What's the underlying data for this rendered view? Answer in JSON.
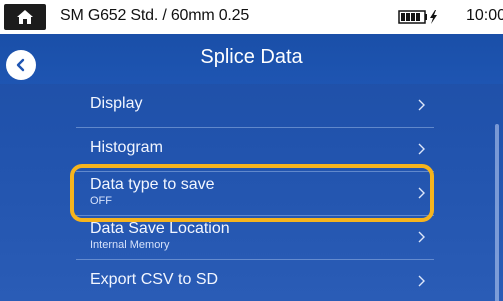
{
  "status_bar": {
    "profile": "SM G652 Std. / 60mm 0.25",
    "time": "10:00",
    "home_icon": "home-icon",
    "battery_icon": "battery-charging-icon"
  },
  "header": {
    "title": "Splice Data",
    "back_icon": "chevron-left-icon"
  },
  "menu": {
    "items": [
      {
        "label": "Display",
        "value": ""
      },
      {
        "label": "Histogram",
        "value": ""
      },
      {
        "label": "Data type to save",
        "value": "OFF"
      },
      {
        "label": "Data Save Location",
        "value": "Internal Memory"
      },
      {
        "label": "Export CSV to SD",
        "value": ""
      }
    ]
  },
  "colors": {
    "background": "#2153ad",
    "highlight": "#f6b41d",
    "text": "#f2f6ff"
  }
}
